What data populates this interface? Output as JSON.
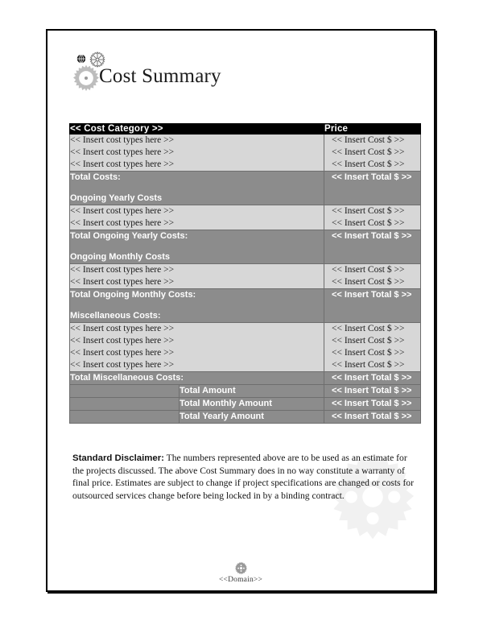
{
  "document": {
    "title": "Cost Summary"
  },
  "icons": {
    "gear_small_dark": "gear-icon",
    "gear_mid_outline": "gear-icon",
    "gear_large_light": "gear-icon",
    "watermark_gear": "gear-icon",
    "footer_gear": "gear-icon"
  },
  "colors": {
    "header_bg": "#000000",
    "header_text": "#ffffff",
    "row_light_bg": "#d7d7d7",
    "row_dark_bg": "#8c8c8c",
    "border": "#6e6e6e",
    "page_border": "#000000",
    "watermark": "#f0f0f0"
  },
  "table": {
    "header": {
      "category": "<< Cost Category >>",
      "price": "Price"
    },
    "placeholders": {
      "cost_type": "<< Insert cost types here >>",
      "cost_value": "<< Insert Cost $ >>",
      "total_value": "<< Insert Total $ >>"
    },
    "sections": [
      {
        "kind": "items",
        "rows": [
          {
            "label": "<< Insert cost types here >>",
            "price": "<< Insert Cost $ >>"
          },
          {
            "label": "<< Insert cost types here >>",
            "price": "<< Insert Cost $ >>"
          },
          {
            "label": "<< Insert cost types here >>",
            "price": "<< Insert Cost $ >>"
          }
        ]
      },
      {
        "kind": "total",
        "lines": [
          "Total Costs:",
          "Ongoing Yearly Costs"
        ],
        "price": "<< Insert Total $ >>"
      },
      {
        "kind": "items",
        "rows": [
          {
            "label": "<< Insert cost types here >>",
            "price": "<< Insert Cost $ >>"
          },
          {
            "label": "<< Insert cost types here >>",
            "price": "<< Insert Cost $ >>"
          }
        ]
      },
      {
        "kind": "total",
        "lines": [
          "Total Ongoing Yearly Costs:",
          "Ongoing Monthly Costs"
        ],
        "price": "<< Insert Total $ >>"
      },
      {
        "kind": "items",
        "rows": [
          {
            "label": "<< Insert cost types here >>",
            "price": "<< Insert Cost $ >>"
          },
          {
            "label": "<< Insert cost types here >>",
            "price": "<< Insert Cost $ >>"
          }
        ]
      },
      {
        "kind": "total",
        "lines": [
          "Total Ongoing Monthly Costs:",
          "Miscellaneous Costs:"
        ],
        "price": "<< Insert Total $ >>"
      },
      {
        "kind": "items",
        "rows": [
          {
            "label": "<< Insert cost types here >>",
            "price": "<< Insert Cost $ >>"
          },
          {
            "label": "<< Insert cost types here >>",
            "price": "<< Insert Cost $ >>"
          },
          {
            "label": "<< Insert cost types here >>",
            "price": "<< Insert Cost $ >>"
          },
          {
            "label": "<< Insert cost types here >>",
            "price": "<< Insert Cost $ >>"
          }
        ]
      },
      {
        "kind": "total",
        "lines": [
          "Total Miscellaneous Costs:"
        ],
        "price": "<< Insert Total $ >>"
      }
    ],
    "summary_rows": [
      {
        "spacer": "",
        "label": "Total Amount",
        "price": "<< Insert Total $ >>"
      },
      {
        "spacer": "",
        "label": "Total Monthly Amount",
        "price": "<< Insert Total $ >>"
      },
      {
        "spacer": "",
        "label": "Total Yearly Amount",
        "price": "<< Insert Total $ >>"
      }
    ]
  },
  "disclaimer": {
    "lead": "Standard Disclaimer:",
    "body": " The numbers represented above are to be used as an estimate for the projects discussed. The above Cost Summary does in no way constitute a warranty of final price. Estimates are subject to change if project specifications are changed or costs for outsourced services change before being locked in by a binding contract."
  },
  "footer": {
    "domain": "<<Domain>>"
  }
}
